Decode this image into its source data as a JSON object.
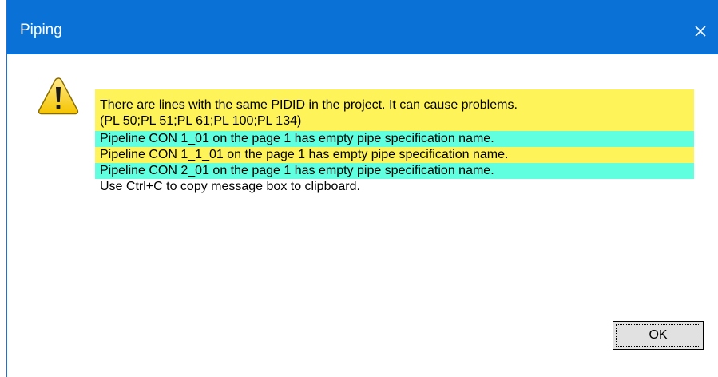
{
  "window": {
    "title": "Piping",
    "close_icon": "close-icon",
    "titlebar_color": "#0a72d6"
  },
  "dialog": {
    "icon": "warning-icon",
    "messages": [
      {
        "lines": [
          "There are lines with the same PIDID in the project. It can cause problems.",
          "(PL 50;PL 51;PL 61;PL 100;PL 134)"
        ],
        "highlight": "#fff35a"
      },
      {
        "lines": [
          "Pipeline CON 1_01 on the page 1 has empty pipe specification name."
        ],
        "highlight": "#60ffdf"
      },
      {
        "lines": [
          "Pipeline CON 1_1_01 on the page 1 has empty pipe specification name."
        ],
        "highlight": "#fff35a"
      },
      {
        "lines": [
          "Pipeline CON 2_01 on the page 1 has empty pipe specification name."
        ],
        "highlight": "#60ffdf"
      },
      {
        "lines": [
          "Use Ctrl+C to copy message box to clipboard."
        ],
        "highlight": ""
      }
    ],
    "ok_label": "OK"
  }
}
